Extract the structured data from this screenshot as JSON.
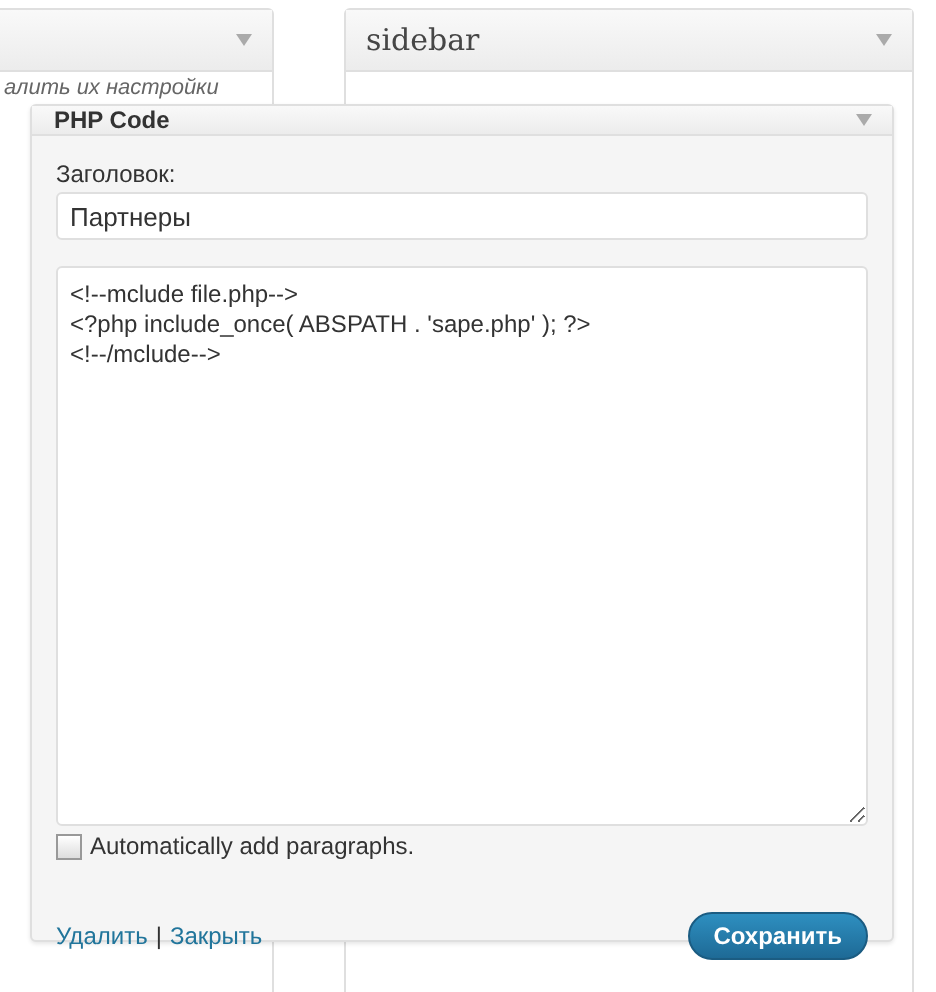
{
  "background_panels": [
    {
      "text": "алить их настройки"
    },
    {
      "title": "sidebar"
    }
  ],
  "widget": {
    "title": "PHP Code",
    "title_label": "Заголовок:",
    "title_value": "Партнеры",
    "code": "<!--mclude file.php-->\n<?php include_once( ABSPATH . 'sape.php' ); ?>\n<!--/mclude-->",
    "auto_paragraphs": {
      "label": "Automatically add paragraphs.",
      "checked": false
    },
    "links": [
      "Удалить",
      "Закрыть"
    ],
    "separator": "|",
    "save_button": "Сохранить"
  }
}
